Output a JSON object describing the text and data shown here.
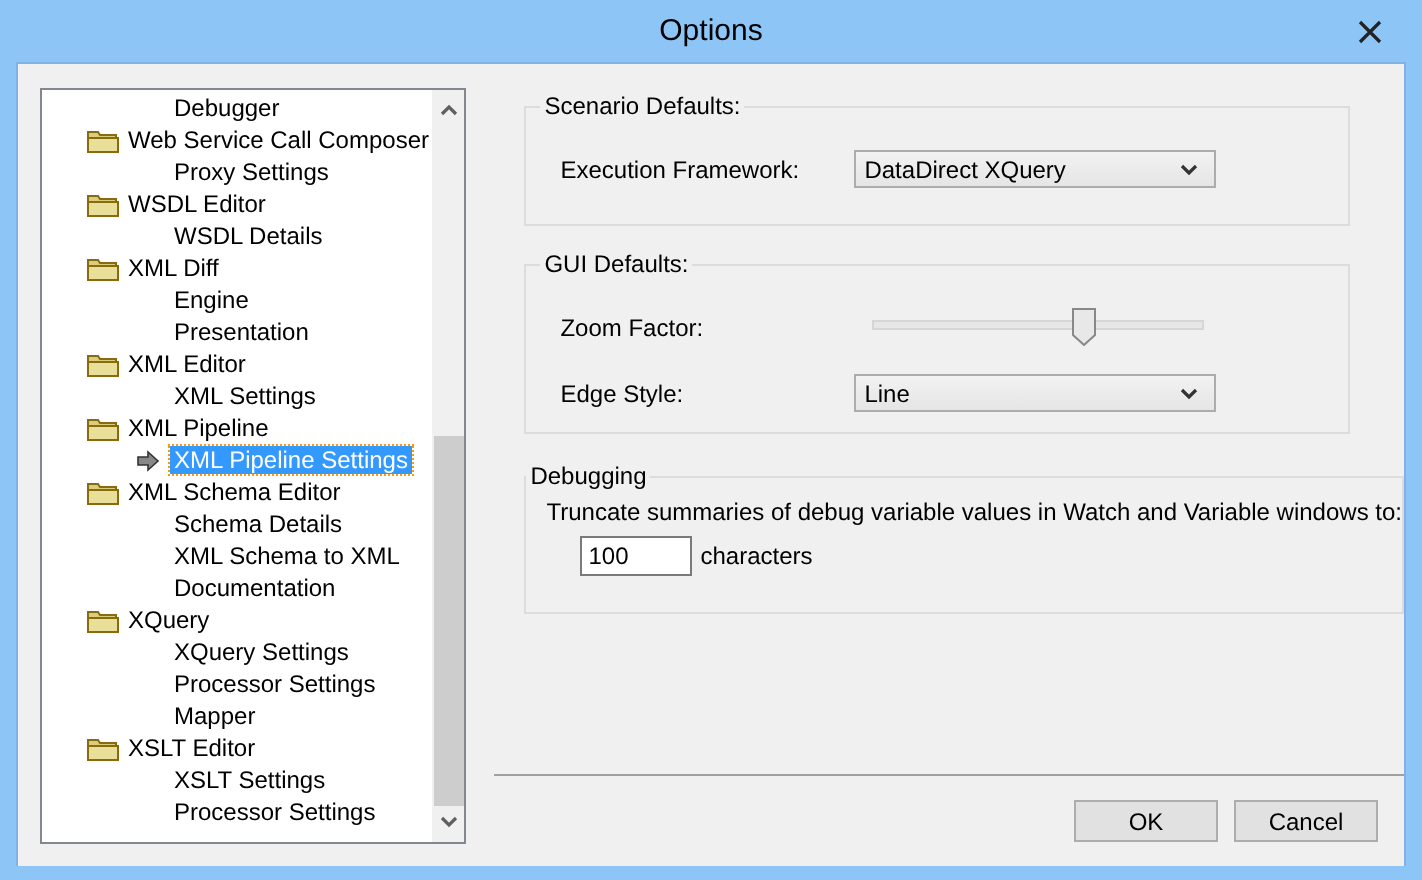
{
  "window": {
    "title": "Options"
  },
  "tree": [
    {
      "children": [
        {
          "label": "Debugger",
          "selected": false
        }
      ]
    },
    {
      "label": "Web Service Call Composer",
      "children": [
        {
          "label": "Proxy Settings",
          "selected": false
        }
      ]
    },
    {
      "label": "WSDL Editor",
      "children": [
        {
          "label": "WSDL Details",
          "selected": false
        }
      ]
    },
    {
      "label": "XML Diff",
      "children": [
        {
          "label": "Engine",
          "selected": false
        },
        {
          "label": "Presentation",
          "selected": false
        }
      ]
    },
    {
      "label": "XML Editor",
      "children": [
        {
          "label": "XML Settings",
          "selected": false
        }
      ]
    },
    {
      "label": "XML Pipeline",
      "children": [
        {
          "label": "XML Pipeline Settings",
          "selected": true
        }
      ]
    },
    {
      "label": "XML Schema Editor",
      "children": [
        {
          "label": "Schema Details",
          "selected": false
        },
        {
          "label": "XML Schema to XML",
          "selected": false
        },
        {
          "label": "Documentation",
          "selected": false
        }
      ]
    },
    {
      "label": "XQuery",
      "children": [
        {
          "label": "XQuery Settings",
          "selected": false
        },
        {
          "label": "Processor Settings",
          "selected": false
        },
        {
          "label": "Mapper",
          "selected": false
        }
      ]
    },
    {
      "label": "XSLT Editor",
      "children": [
        {
          "label": "XSLT Settings",
          "selected": false
        },
        {
          "label": "Processor Settings",
          "selected": false
        }
      ]
    }
  ],
  "scenario_defaults": {
    "title": "Scenario Defaults:",
    "execution_framework": {
      "label": "Execution Framework:",
      "value": "DataDirect XQuery"
    }
  },
  "gui_defaults": {
    "title": "GUI Defaults:",
    "zoom_factor": {
      "label": "Zoom Factor:",
      "level": 0.64
    },
    "edge_style": {
      "label": "Edge Style:",
      "value": "Line"
    }
  },
  "debugging": {
    "title": "Debugging",
    "description": "Truncate summaries of debug variable values in Watch and Variable windows to:",
    "value": "100",
    "unit": "characters"
  },
  "buttons": [
    "OK",
    "Cancel"
  ]
}
